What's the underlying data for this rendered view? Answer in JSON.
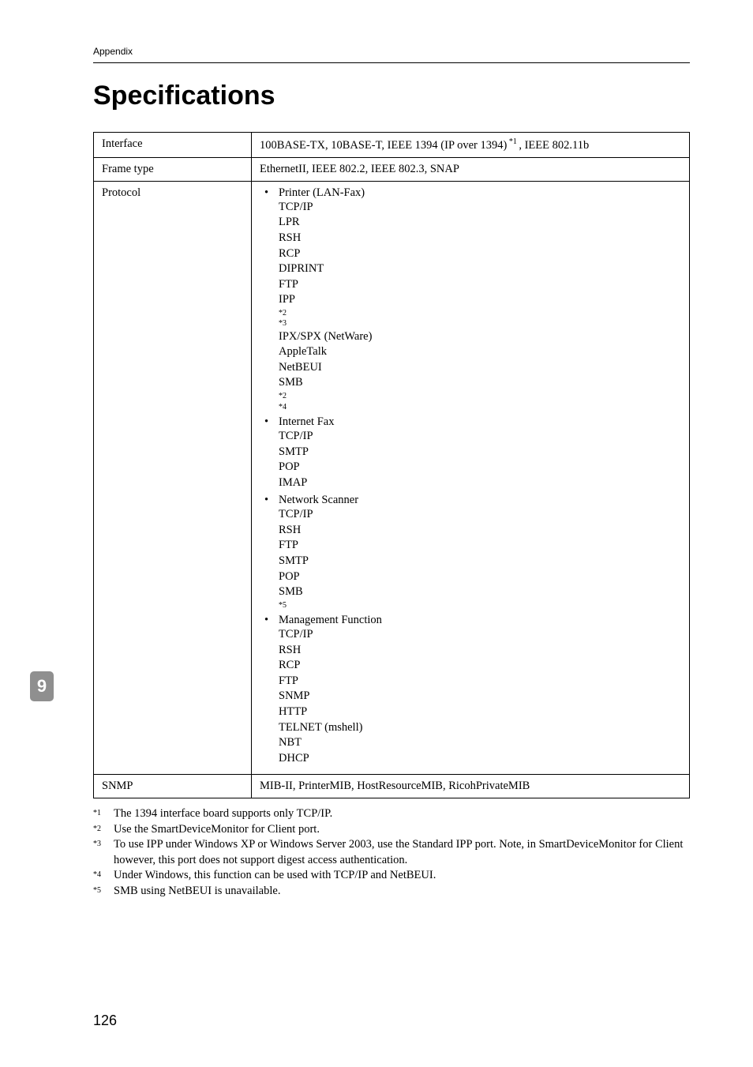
{
  "header": {
    "section": "Appendix"
  },
  "title": "Specifications",
  "table": {
    "rows": {
      "interface": {
        "label": "Interface",
        "value_prefix": "100BASE-TX, 10BASE-T, IEEE 1394 (IP over 1394)",
        "value_sup": " *1 ",
        "value_suffix": ", IEEE 802.11b"
      },
      "frameType": {
        "label": "Frame type",
        "value": "EthernetII, IEEE 802.2, IEEE 802.3, SNAP"
      },
      "protocol": {
        "label": "Protocol",
        "groups": [
          {
            "title": "Printer (LAN-Fax)",
            "lines": [
              "TCP/IP",
              "LPR",
              "RSH",
              "RCP",
              "DIPRINT",
              "FTP",
              "IPP  *2  *3",
              "IPX/SPX (NetWare)",
              "AppleTalk",
              "NetBEUI",
              "SMB *2  *4"
            ]
          },
          {
            "title": "Internet Fax",
            "lines": [
              "TCP/IP",
              "SMTP",
              "POP",
              "IMAP"
            ]
          },
          {
            "title": "Network Scanner",
            "lines": [
              "TCP/IP",
              "RSH",
              "FTP",
              "SMTP",
              "POP",
              "SMB *5"
            ]
          },
          {
            "title": "Management Function",
            "lines": [
              "TCP/IP",
              "RSH",
              "RCP",
              "FTP",
              "SNMP",
              "HTTP",
              "TELNET (mshell)",
              "NBT",
              "DHCP"
            ]
          }
        ]
      },
      "snmp": {
        "label": "SNMP",
        "value": "MIB-II, PrinterMIB, HostResourceMIB, RicohPrivateMIB"
      }
    }
  },
  "footnotes": [
    {
      "mark": "*1",
      "text": "The 1394 interface board supports only TCP/IP."
    },
    {
      "mark": "*2",
      "text": "Use the SmartDeviceMonitor for Client port."
    },
    {
      "mark": "*3",
      "text": "To use IPP under Windows XP or Windows Server 2003, use the Standard IPP port. Note, in SmartDeviceMonitor for Client however, this port does not support digest access authentication."
    },
    {
      "mark": "*4",
      "text": "Under Windows, this function can be used with TCP/IP and NetBEUI."
    },
    {
      "mark": "*5",
      "text": "SMB using NetBEUI is unavailable."
    }
  ],
  "sideTab": "9",
  "pageNumber": "126"
}
